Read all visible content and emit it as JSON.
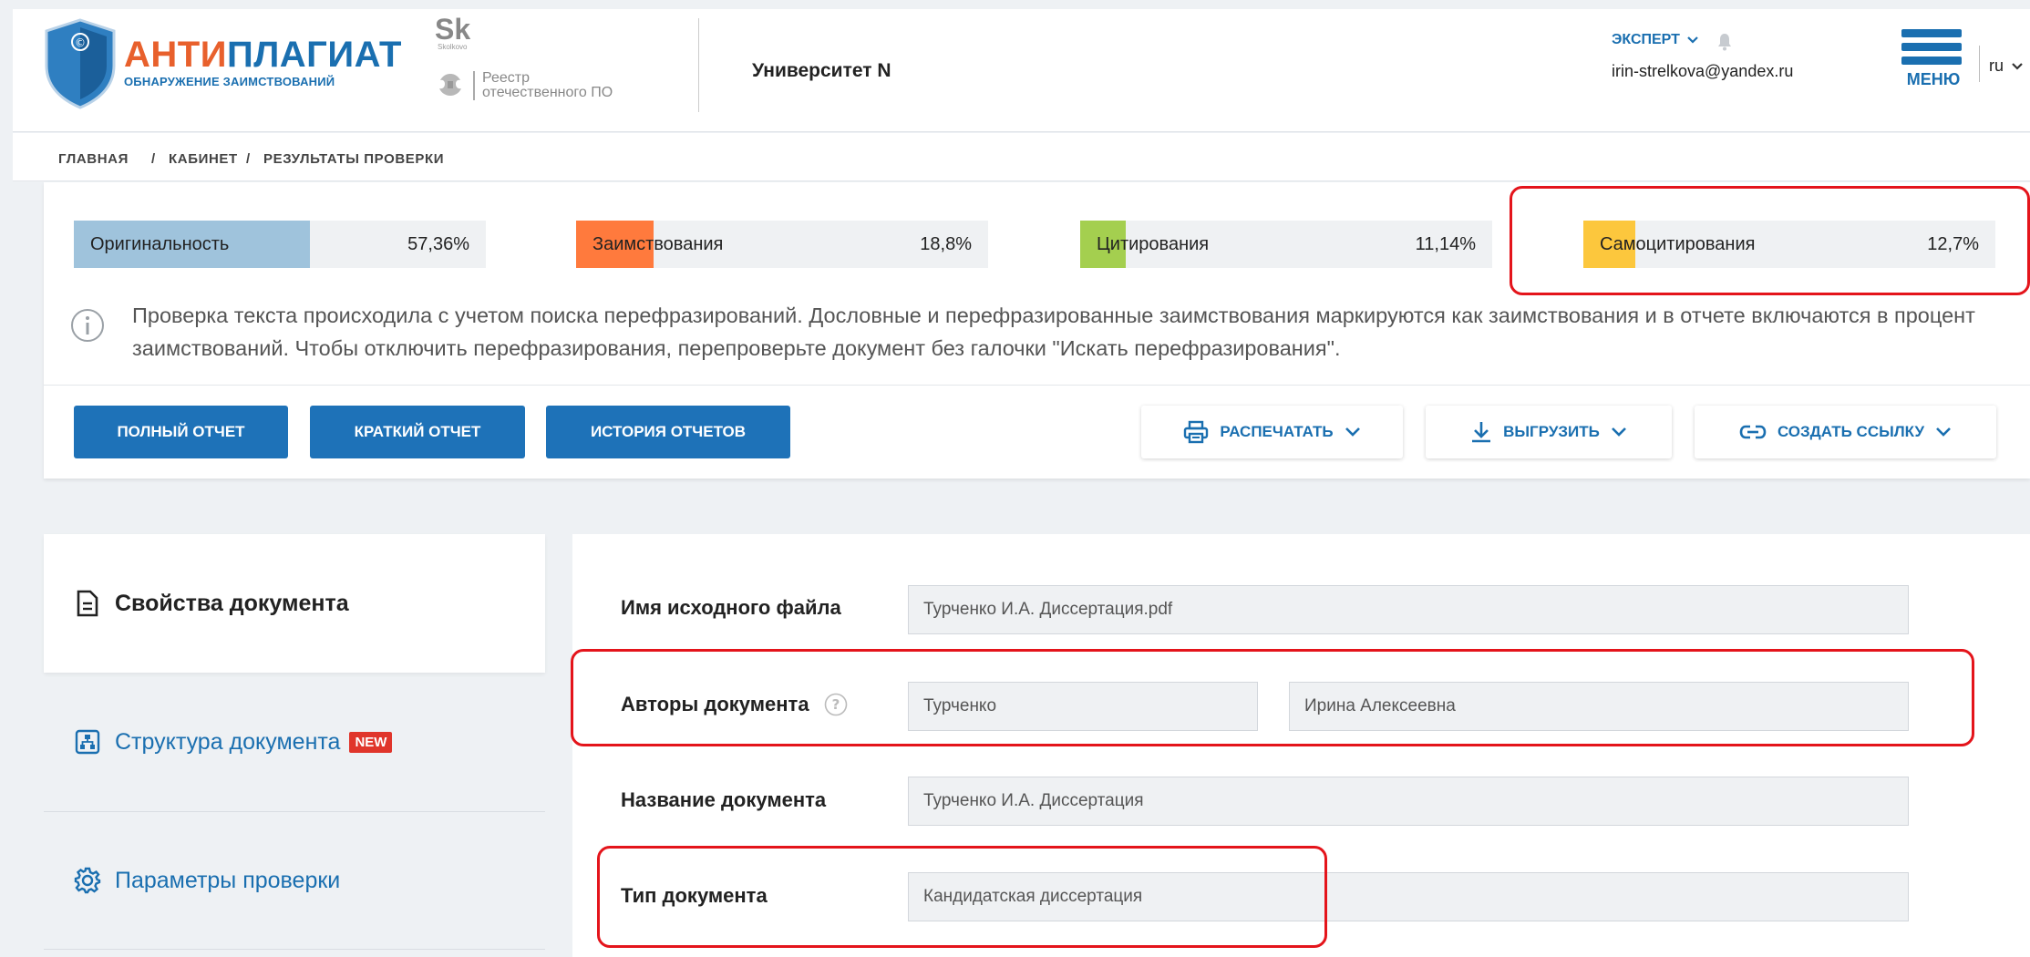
{
  "header": {
    "logo": {
      "part1": "АНТИ",
      "part2": "ПЛАГИАТ",
      "subtitle": "ОБНАРУЖЕНИЕ ЗАИМСТВОВАНИЙ"
    },
    "skolkovo": {
      "logo": "Sk",
      "caption": "Skolkovo"
    },
    "registry": {
      "line1": "Реестр",
      "line2": "отечественного ПО"
    },
    "university": "Университет N",
    "role": "ЭКСПЕРТ",
    "email": "irin-strelkova@yandex.ru",
    "menu_label": "МЕНЮ",
    "lang": "ru"
  },
  "breadcrumb": {
    "home": "ГЛАВНАЯ",
    "cabinet": "КАБИНЕТ",
    "current": "РЕЗУЛЬТАТЫ ПРОВЕРКИ",
    "separator": "/"
  },
  "stats": [
    {
      "label": "Оригинальность",
      "value": "57,36%",
      "fraction": 0.5736,
      "color": "#9fc3dc"
    },
    {
      "label": "Заимствования",
      "value": "18,8%",
      "fraction": 0.188,
      "color": "#ff7a3d"
    },
    {
      "label": "Цитирования",
      "value": "11,14%",
      "fraction": 0.1114,
      "color": "#a4cf4f"
    },
    {
      "label": "Самоцитирования",
      "value": "12,7%",
      "fraction": 0.127,
      "color": "#fcc73d"
    }
  ],
  "info_text": "Проверка текста происходила с учетом поиска перефразирований. Дословные и перефразированные заимствования маркируются как заимствования и в отчете включаются в процент заимствований. Чтобы отключить перефразирования, перепроверьте документ без галочки \"Искать перефразирования\".",
  "buttons": {
    "full_report": "ПОЛНЫЙ ОТЧЕТ",
    "short_report": "КРАТКИЙ ОТЧЕТ",
    "history": "ИСТОРИЯ ОТЧЕТОВ",
    "print": "РАСПЕЧАТАТЬ",
    "download": "ВЫГРУЗИТЬ",
    "create_link": "СОЗДАТЬ ССЫЛКУ"
  },
  "sidenav": {
    "properties": "Свойства документа",
    "structure": "Структура документа",
    "new_badge": "NEW",
    "params": "Параметры проверки"
  },
  "props": {
    "filename": {
      "label": "Имя исходного файла",
      "value": "Турченко И.А. Диссертация.pdf"
    },
    "authors": {
      "label": "Авторы документа",
      "last_name": "Турченко",
      "first_name": "Ирина Алексеевна"
    },
    "title": {
      "label": "Название документа",
      "value": "Турченко И.А. Диссертация"
    },
    "type": {
      "label": "Тип документа",
      "value": "Кандидатская диссертация"
    }
  },
  "colors": {
    "brand_blue": "#1e72b8",
    "brand_orange": "#e8602c",
    "highlight_red": "#e4141b"
  }
}
